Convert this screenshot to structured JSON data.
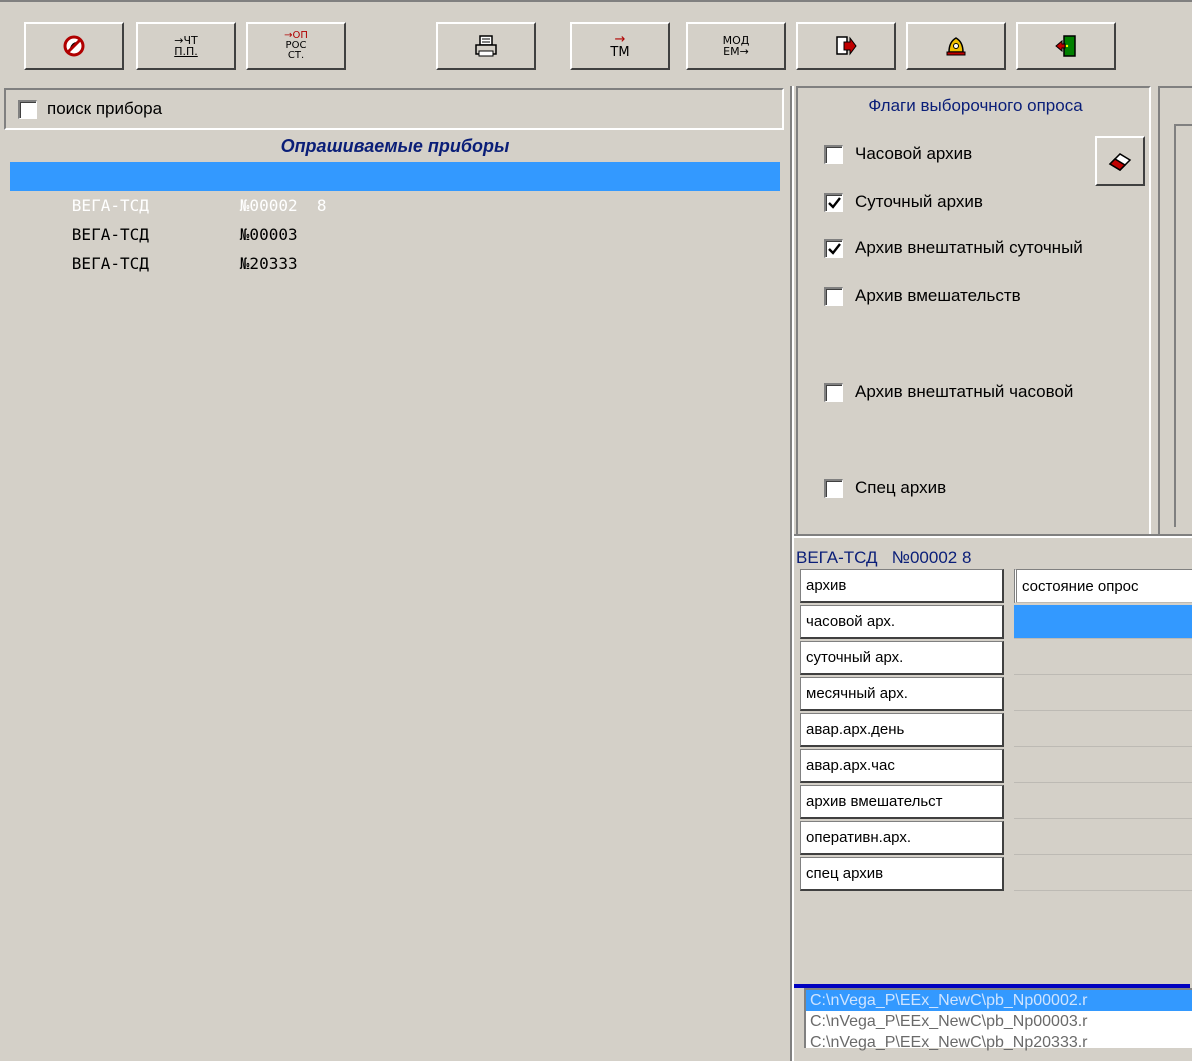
{
  "toolbar": {
    "buttons": [
      {
        "name": "stop-button",
        "icon": "no-phone-icon"
      },
      {
        "name": "read-pp-button",
        "icon": "read-pp-icon",
        "line1": "→ЧТ",
        "line2": "П.П."
      },
      {
        "name": "poll-ros-button",
        "icon": "poll-ros-icon",
        "line1": "→ОП",
        "line2": "РОС",
        "line3": "СТ."
      },
      {
        "name": "print-button",
        "icon": "printer-icon"
      },
      {
        "name": "tm-button",
        "icon": "tm-icon",
        "line1": "→",
        "line2": "TM"
      },
      {
        "name": "modem-button",
        "icon": "modem-icon",
        "line1": "МОД",
        "line2": "ЕМ→"
      },
      {
        "name": "export-button",
        "icon": "export-arrow-icon"
      },
      {
        "name": "alarm-button",
        "icon": "alarm-bell-icon"
      },
      {
        "name": "exit-button",
        "icon": "exit-door-icon"
      }
    ]
  },
  "search": {
    "label": "поиск прибора",
    "checked": false
  },
  "device_list": {
    "title": "Опрашиваемые приборы",
    "items": [
      {
        "name": "ВЕГА-ТСД",
        "number": "№00002  8",
        "selected": true
      },
      {
        "name": "ВЕГА-ТСД",
        "number": "№00003",
        "selected": false
      },
      {
        "name": "ВЕГА-ТСД",
        "number": "№20333",
        "selected": false
      }
    ]
  },
  "flags": {
    "title": "Флаги выборочного опроса",
    "items": [
      {
        "label": "Часовой архив",
        "checked": false
      },
      {
        "label": "Суточный архив",
        "checked": true
      },
      {
        "label": "Архив внештатный суточный",
        "checked": true
      },
      {
        "label": "Архив вмешательств",
        "checked": false
      },
      {
        "label": "Архив внештатный часовой",
        "checked": false
      },
      {
        "label": "Спец архив",
        "checked": false
      }
    ]
  },
  "status": {
    "device": "ВЕГА-ТСД   №00002 8",
    "header": {
      "archive": "архив",
      "state": "состояние опрос"
    },
    "rows": [
      {
        "archive": "часовой арх.",
        "state": "",
        "active": true
      },
      {
        "archive": "суточный арх.",
        "state": "",
        "active": false
      },
      {
        "archive": "месячный арх.",
        "state": "",
        "active": false
      },
      {
        "archive": "авар.арх.день",
        "state": "",
        "active": false
      },
      {
        "archive": "авар.арх.час",
        "state": "",
        "active": false
      },
      {
        "archive": "архив вмешательст",
        "state": "",
        "active": false
      },
      {
        "archive": "оперативн.арх.",
        "state": "",
        "active": false
      },
      {
        "archive": "спец архив",
        "state": "",
        "active": false
      }
    ]
  },
  "log": {
    "items": [
      {
        "path": "C:\\nVega_P\\EEx_NewC\\pb_Np00002.r",
        "selected": true
      },
      {
        "path": "C:\\nVega_P\\EEx_NewC\\pb_Np00003.r",
        "selected": false
      },
      {
        "path": "C:\\nVega_P\\EEx_NewC\\pb_Np20333.r",
        "selected": false
      }
    ]
  },
  "colors": {
    "selection": "#3399ff",
    "title_blue": "#0a1e78",
    "window_bg": "#d4d0c8"
  }
}
